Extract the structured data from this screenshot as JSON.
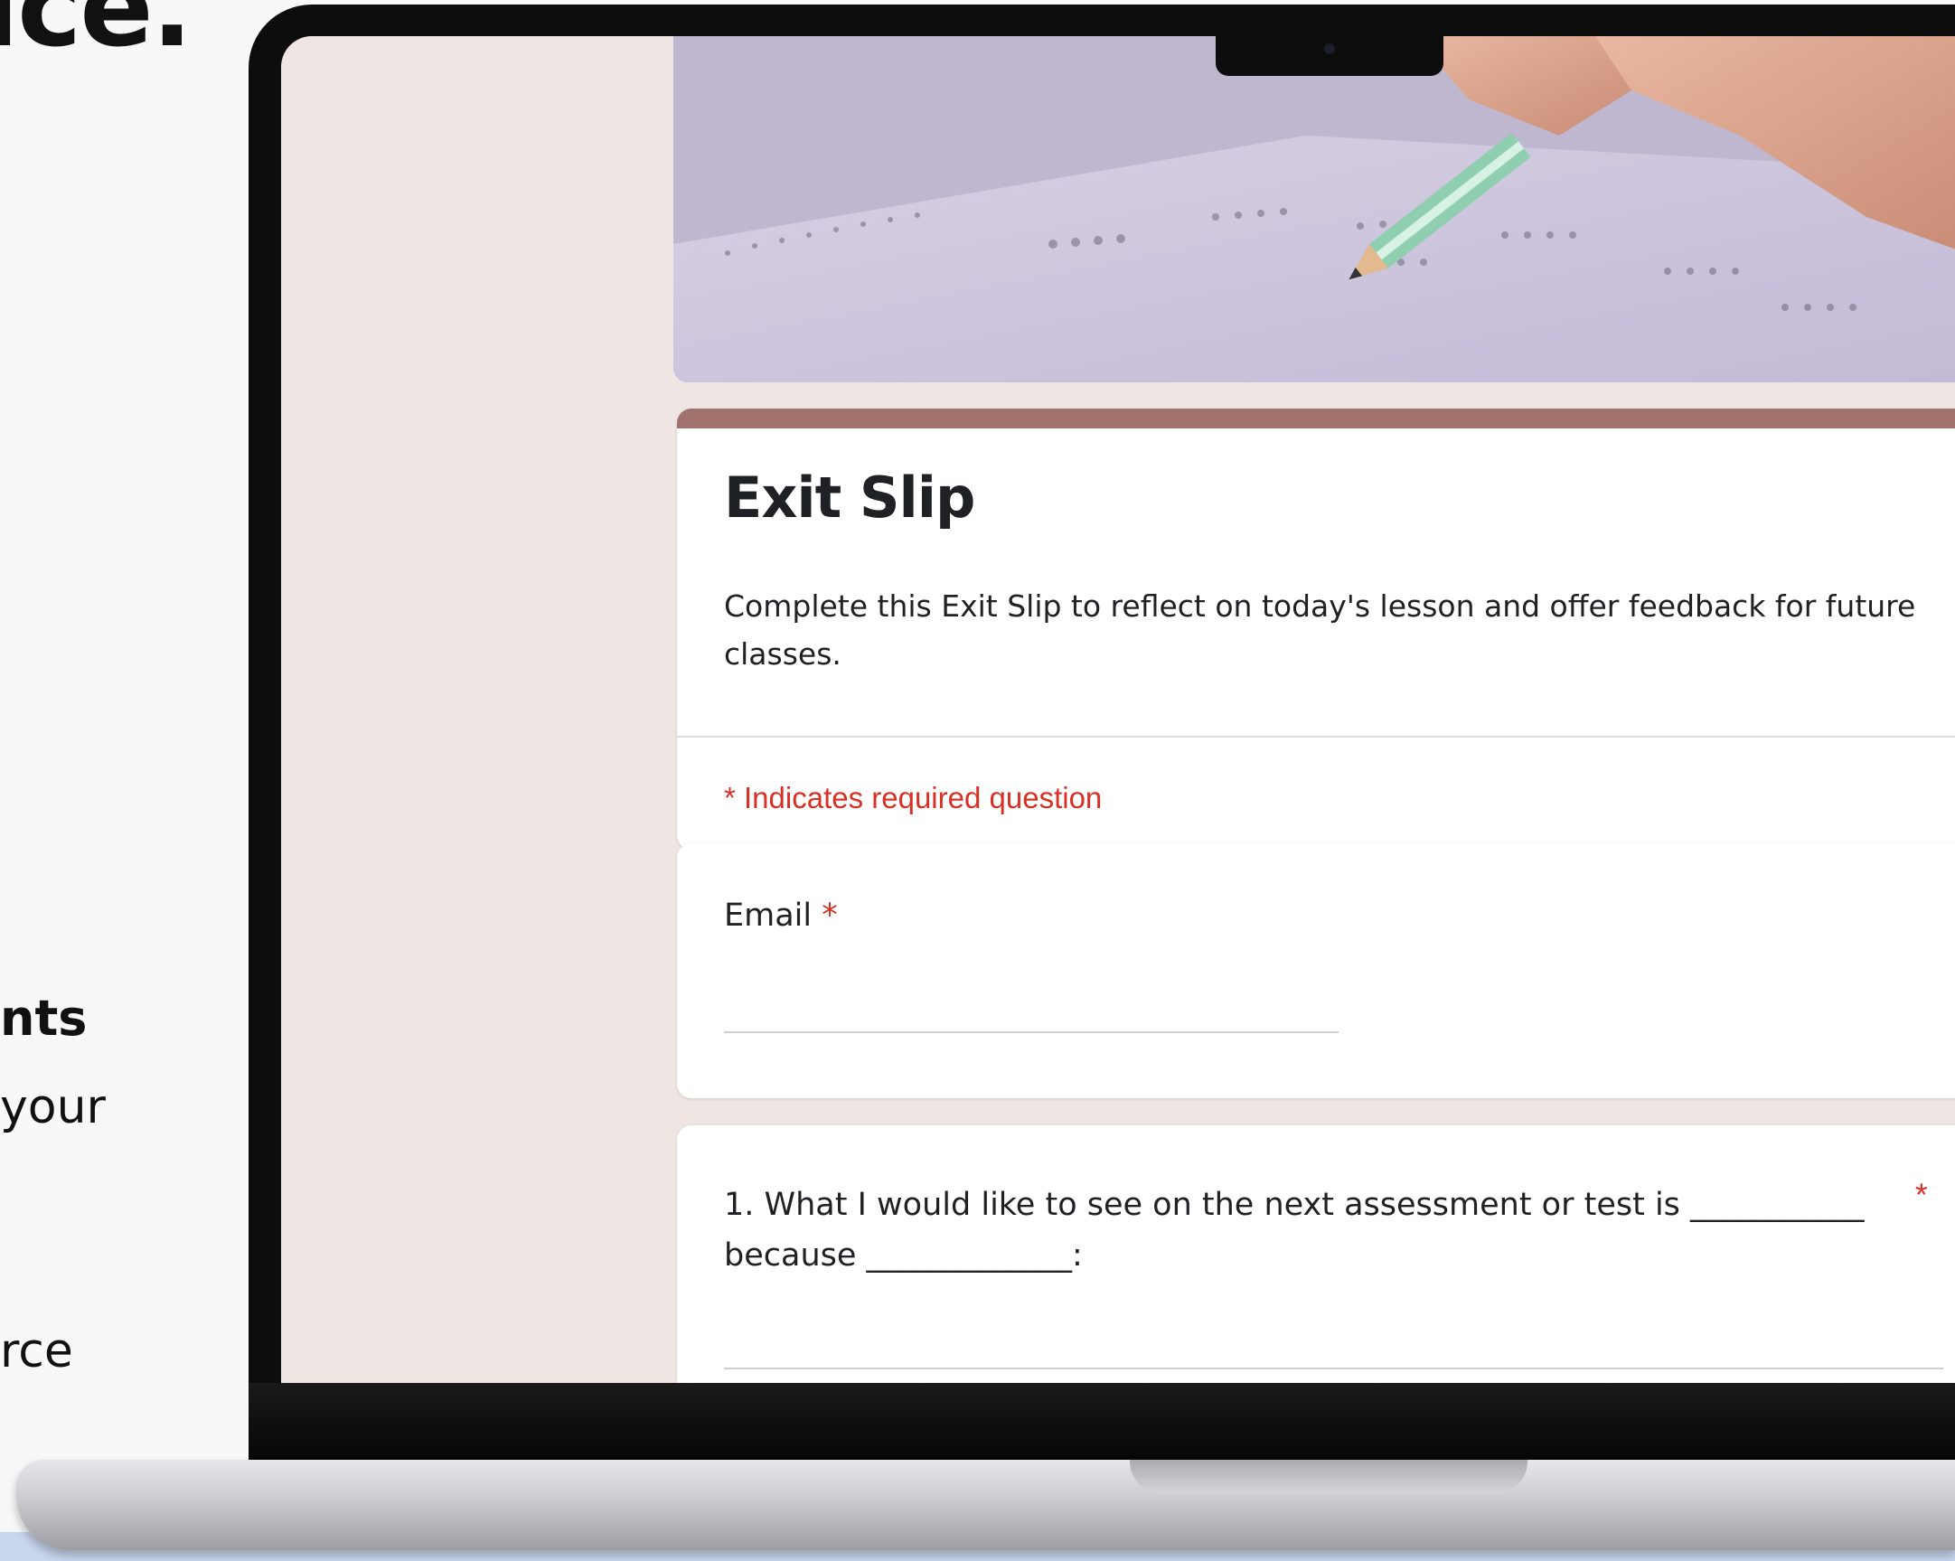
{
  "slide": {
    "heading_fragment": "ice.",
    "subheading_fragment": "nts",
    "line1_fragment": "your",
    "line2_fragment": "rce"
  },
  "form": {
    "title": "Exit Slip",
    "description": "Complete this Exit Slip to reflect on today's lesson and offer feedback for future classes.",
    "required_note": "* Indicates required question",
    "accent_color": "#a0736e",
    "background_color": "#efe5e3",
    "questions": [
      {
        "label": "Email",
        "required_mark": "*",
        "value": ""
      },
      {
        "label": "1. What I would like to see on the next assessment or test is ___________ because _____________:",
        "required_mark": "*",
        "value": ""
      }
    ]
  },
  "header_image": {
    "description_icon": "answer-sheet-pencil-photo"
  }
}
